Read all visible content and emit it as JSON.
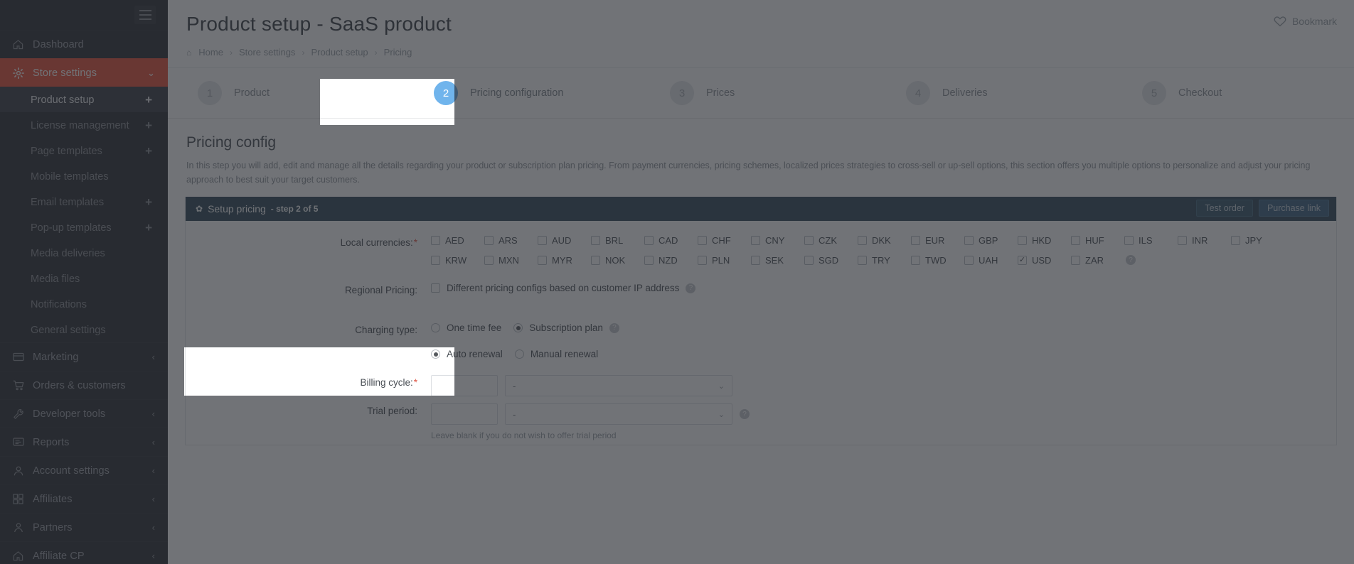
{
  "sidebar": {
    "toggle_icon": "hamburger-icon",
    "items": [
      {
        "label": "Dashboard",
        "icon": "home-icon",
        "caret": "",
        "active": false
      },
      {
        "label": "Store settings",
        "icon": "gear-icon",
        "caret": "⌄",
        "active": true
      }
    ],
    "sub_items": [
      {
        "label": "Product setup",
        "plus": "+",
        "selected": true
      },
      {
        "label": "License management",
        "plus": "+",
        "selected": false
      },
      {
        "label": "Page templates",
        "plus": "+",
        "selected": false
      },
      {
        "label": "Mobile templates",
        "plus": "",
        "selected": false
      },
      {
        "label": "Email templates",
        "plus": "+",
        "selected": false
      },
      {
        "label": "Pop-up templates",
        "plus": "+",
        "selected": false
      },
      {
        "label": "Media deliveries",
        "plus": "",
        "selected": false
      },
      {
        "label": "Media files",
        "plus": "",
        "selected": false
      },
      {
        "label": "Notifications",
        "plus": "",
        "selected": false
      },
      {
        "label": "General settings",
        "plus": "",
        "selected": false
      }
    ],
    "bottom_items": [
      {
        "label": "Marketing",
        "icon": "card-icon",
        "caret": "‹"
      },
      {
        "label": "Orders & customers",
        "icon": "cart-icon",
        "caret": ""
      },
      {
        "label": "Developer tools",
        "icon": "wrench-icon",
        "caret": "‹"
      },
      {
        "label": "Reports",
        "icon": "chat-icon",
        "caret": "‹"
      },
      {
        "label": "Account settings",
        "icon": "user-icon",
        "caret": "‹"
      },
      {
        "label": "Affiliates",
        "icon": "grid-icon",
        "caret": "‹"
      },
      {
        "label": "Partners",
        "icon": "partner-icon",
        "caret": "‹"
      },
      {
        "label": "Affiliate CP",
        "icon": "home-icon",
        "caret": "‹"
      }
    ]
  },
  "header": {
    "title": "Product setup - SaaS product",
    "bookmark_label": "Bookmark",
    "bookmark_icon": "heart-icon",
    "breadcrumb": [
      {
        "label": "Home",
        "icon": "home-icon"
      },
      {
        "label": "Store settings",
        "icon": ""
      },
      {
        "label": "Product setup",
        "icon": ""
      },
      {
        "label": "Pricing",
        "icon": ""
      }
    ],
    "breadcrumb_sep": "›"
  },
  "stepper": {
    "steps": [
      {
        "num": "1",
        "label": "Product",
        "current": false
      },
      {
        "num": "2",
        "label": "Pricing configuration",
        "current": true
      },
      {
        "num": "3",
        "label": "Prices",
        "current": false
      },
      {
        "num": "4",
        "label": "Deliveries",
        "current": false
      },
      {
        "num": "5",
        "label": "Checkout",
        "current": false
      }
    ]
  },
  "section": {
    "heading": "Pricing config",
    "description": "In this step you will add, edit and manage all the details regarding your product or subscription plan pricing. From payment currencies, pricing schemes, localized prices strategies to cross-sell or up-sell options, this section offers you multiple options to personalize and adjust your pricing approach to best suit your target customers."
  },
  "panel": {
    "gear_icon": "gear-icon",
    "title": "Setup pricing",
    "subtitle": "- step 2 of 5",
    "buttons": [
      {
        "label": "Test order"
      },
      {
        "label": "Purchase link"
      }
    ]
  },
  "form": {
    "currencies_label": "Local currencies:",
    "currencies_required": "*",
    "currencies": [
      {
        "code": "AED",
        "checked": false
      },
      {
        "code": "ARS",
        "checked": false
      },
      {
        "code": "AUD",
        "checked": false
      },
      {
        "code": "BRL",
        "checked": false
      },
      {
        "code": "CAD",
        "checked": false
      },
      {
        "code": "CHF",
        "checked": false
      },
      {
        "code": "CNY",
        "checked": false
      },
      {
        "code": "CZK",
        "checked": false
      },
      {
        "code": "DKK",
        "checked": false
      },
      {
        "code": "EUR",
        "checked": false
      },
      {
        "code": "GBP",
        "checked": false
      },
      {
        "code": "HKD",
        "checked": false
      },
      {
        "code": "HUF",
        "checked": false
      },
      {
        "code": "ILS",
        "checked": false
      },
      {
        "code": "INR",
        "checked": false
      },
      {
        "code": "JPY",
        "checked": false
      },
      {
        "code": "KRW",
        "checked": false
      },
      {
        "code": "MXN",
        "checked": false
      },
      {
        "code": "MYR",
        "checked": false
      },
      {
        "code": "NOK",
        "checked": false
      },
      {
        "code": "NZD",
        "checked": false
      },
      {
        "code": "PLN",
        "checked": false
      },
      {
        "code": "SEK",
        "checked": false
      },
      {
        "code": "SGD",
        "checked": false
      },
      {
        "code": "TRY",
        "checked": false
      },
      {
        "code": "TWD",
        "checked": false
      },
      {
        "code": "UAH",
        "checked": false
      },
      {
        "code": "USD",
        "checked": true
      },
      {
        "code": "ZAR",
        "checked": false
      }
    ],
    "currencies_help": "?",
    "regional_label": "Regional Pricing:",
    "regional_option": "Different pricing configs based on customer IP address",
    "regional_checked": false,
    "regional_help": "?",
    "charging_label": "Charging type:",
    "charging_options": [
      {
        "label": "One time fee",
        "selected": false
      },
      {
        "label": "Subscription plan",
        "selected": true
      }
    ],
    "charging_help": "?",
    "renewal_options": [
      {
        "label": "Auto renewal",
        "selected": true
      },
      {
        "label": "Manual renewal",
        "selected": false
      }
    ],
    "billing_label": "Billing cycle:",
    "billing_required": "*",
    "billing_value": "-",
    "billing_number": "",
    "trial_label": "Trial period:",
    "trial_value": "-",
    "trial_number": "",
    "trial_help": "?",
    "trial_hint": "Leave blank if you do not wish to offer trial period",
    "chevron": "⌄"
  },
  "colors": {
    "accent_red": "#e8503a",
    "panel_blue": "#2f4858",
    "step_blue": "#70b4ec",
    "sidebar_bg": "#2b2e33"
  }
}
